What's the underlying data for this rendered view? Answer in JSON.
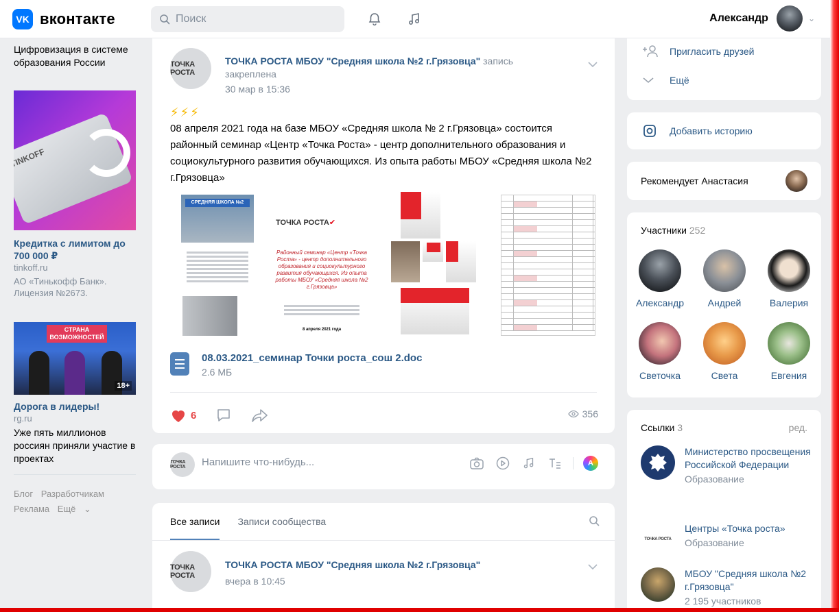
{
  "header": {
    "logo_icon": "vk",
    "logo_text": "вконтакте",
    "search_placeholder": "Поиск",
    "user_name": "Александр"
  },
  "left": {
    "top_text": "Цифровизация в системе образования России",
    "ad1": {
      "brand": "TINKOFF",
      "title": "Кредитка с лимитом до 700 000 ₽",
      "domain": "tinkoff.ru",
      "desc": "АО «Тинькофф Банк». Лицензия №2673."
    },
    "ad2": {
      "banner": "СТРАНА ВОЗМОЖНОСТЕЙ",
      "age": "18+",
      "title": "Дорога в лидеры!",
      "domain": "rg.ru",
      "desc": "Уже пять миллионов россиян приняли участие в проектах"
    },
    "footer": {
      "blog": "Блог",
      "devs": "Разработчикам",
      "ads": "Реклама",
      "more": "Ещё"
    }
  },
  "post": {
    "avatar_logo": "ТОЧКА РОСТА",
    "author": "ТОЧКА РОСТА МБОУ \"Средняя школа №2 г.Грязовца\"",
    "pinned": " запись закреплена",
    "date": "30 мар в 15:36",
    "emoji": "⚡⚡⚡",
    "text": "08 апреля 2021 года на базе МБОУ «Средняя школа № 2 г.Грязовца» состоится районный семинар «Центр «Точка Роста» - центр дополнительного образования и социокультурного развития обучающихся. Из опыта работы МБОУ «Средняя школа №2 г.Грязовца»",
    "gallery": {
      "school_sign": "СРЕДНЯЯ ШКОЛА №2",
      "logo": "ТОЧКА РОСТА",
      "seminar_text": "Районный семинар «Центр «Точка Роста» - центр дополнительного образования и социокультурного развития обучающихся. Из опыта работы МБОУ «Средняя школа №2 г.Грязовца»",
      "date_text": "8 апреля 2021 года"
    },
    "attachment": {
      "name": "08.03.2021_семинар Точки роста_сош 2.doc",
      "size": "2.6 МБ"
    },
    "likes": "6",
    "views": "356"
  },
  "composer": {
    "placeholder": "Напишите что-нибудь..."
  },
  "feed": {
    "tab_all": "Все записи",
    "tab_community": "Записи сообщества",
    "post2_author": "ТОЧКА РОСТА МБОУ \"Средняя школа №2 г.Грязовца\"",
    "post2_date": "вчера в 10:45"
  },
  "right": {
    "invite": "Пригласить друзей",
    "more": "Ещё",
    "add_story": "Добавить историю",
    "recommends": "Рекомендует Анастасия",
    "members_title": "Участники",
    "members_count": "252",
    "members": [
      {
        "name": "Александр",
        "color": "#4a5058"
      },
      {
        "name": "Андрей",
        "color": "#8a8f96"
      },
      {
        "name": "Валерия",
        "color": "#2b2b2b"
      },
      {
        "name": "Светочка",
        "color": "#c4737d"
      },
      {
        "name": "Света",
        "color": "#e89a4a"
      },
      {
        "name": "Евгения",
        "color": "#6d9a5a"
      }
    ],
    "links_title": "Ссылки",
    "links_count": "3",
    "links_edit": "ред.",
    "links": [
      {
        "title": "Министерство просвещения Российской Федерации",
        "sub": "Образование"
      },
      {
        "title": "Центры «Точка роста»",
        "sub": "Образование"
      },
      {
        "title": "МБОУ \"Средняя школа №2 г.Грязовца\"",
        "sub": "2 195 участников"
      }
    ]
  },
  "colors": {
    "accent": "#2a5885",
    "vk_blue": "#0077ff",
    "like_red": "#e64646"
  }
}
